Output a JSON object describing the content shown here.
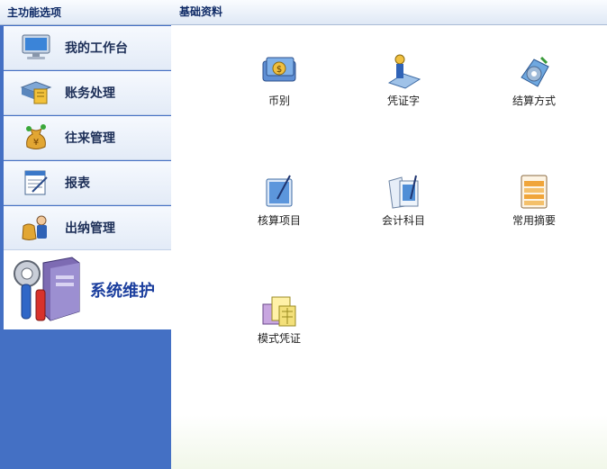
{
  "left_panel": {
    "title": "主功能选项",
    "items": [
      {
        "label": "我的工作台",
        "icon": "monitor-icon"
      },
      {
        "label": "账务处理",
        "icon": "ledger-icon"
      },
      {
        "label": "往来管理",
        "icon": "money-bag-icon"
      },
      {
        "label": "报表",
        "icon": "report-icon"
      },
      {
        "label": "出纳管理",
        "icon": "cashier-icon"
      }
    ],
    "active_item": {
      "label": "系统维护",
      "icon": "system-tools-icon"
    }
  },
  "main_panel": {
    "title": "基础资料",
    "tiles": [
      {
        "label": "币别",
        "icon": "currency-icon"
      },
      {
        "label": "凭证字",
        "icon": "voucher-word-icon"
      },
      {
        "label": "结算方式",
        "icon": "settlement-method-icon"
      },
      {
        "label": "核算项目",
        "icon": "accounting-item-icon"
      },
      {
        "label": "会计科目",
        "icon": "accounting-subject-icon"
      },
      {
        "label": "常用摘要",
        "icon": "summary-icon"
      },
      {
        "label": "模式凭证",
        "icon": "template-voucher-icon"
      }
    ]
  },
  "colors": {
    "left_background": "#4470c4",
    "header_text": "#0e2a66",
    "active_text": "#1c3f9e"
  }
}
